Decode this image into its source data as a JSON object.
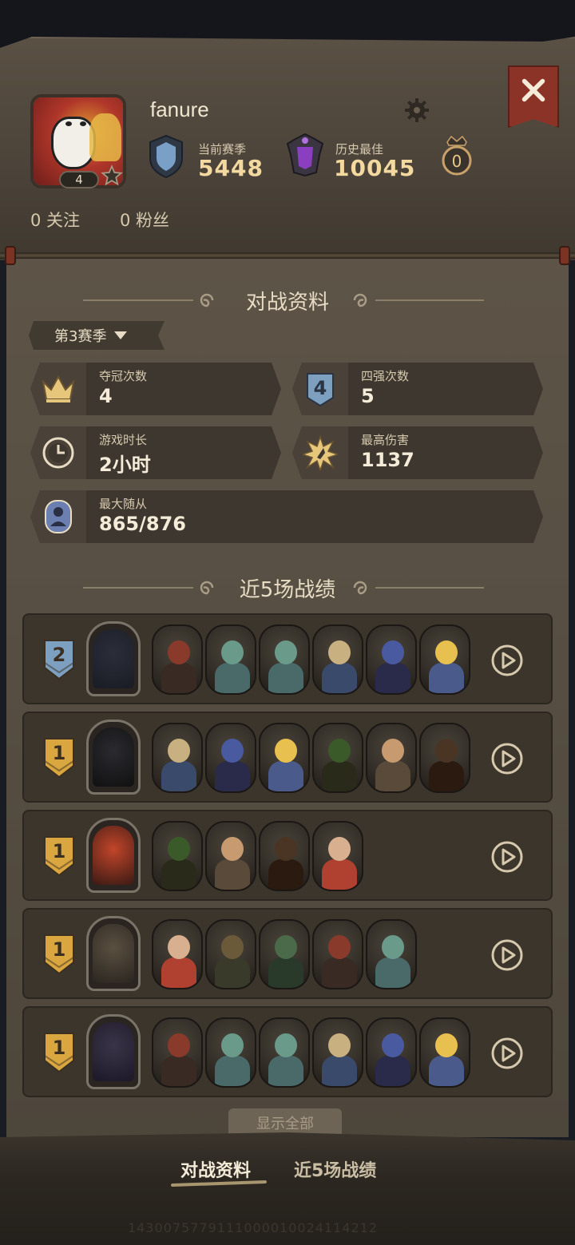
{
  "profile": {
    "username": "fanure",
    "level": "4",
    "current_season_label": "当前赛季",
    "current_season_score": "5448",
    "best_label": "历史最佳",
    "best_score": "10045",
    "coin_count": "0",
    "following": "0 关注",
    "followers": "0 粉丝"
  },
  "battle_stats": {
    "title": "对战资料",
    "season_select": "第3赛季",
    "cards": [
      {
        "label": "夺冠次数",
        "value": "4",
        "icon": "crown-icon"
      },
      {
        "label": "四强次数",
        "value": "5",
        "icon": "top4-badge-icon"
      },
      {
        "label": "游戏时长",
        "value": "2小时",
        "icon": "clock-icon"
      },
      {
        "label": "最高伤害",
        "value": "1137",
        "icon": "burst-icon"
      },
      {
        "label": "最大随从",
        "value": "865/876",
        "icon": "minion-icon"
      }
    ]
  },
  "recent": {
    "title": "近5场战绩",
    "matches": [
      {
        "placement": "2",
        "badge_color": "#7d9fc0",
        "minions": 6
      },
      {
        "placement": "1",
        "badge_color": "#d9a640",
        "minions": 6
      },
      {
        "placement": "1",
        "badge_color": "#d9a640",
        "minions": 4
      },
      {
        "placement": "1",
        "badge_color": "#d9a640",
        "minions": 5
      },
      {
        "placement": "1",
        "badge_color": "#d9a640",
        "minions": 6
      }
    ]
  },
  "show_all_label": "显示全部",
  "tabs": [
    {
      "label": "对战资料",
      "active": true
    },
    {
      "label": "近5场战绩",
      "active": false
    }
  ],
  "footer_faint": "1430075779111000010024114212"
}
